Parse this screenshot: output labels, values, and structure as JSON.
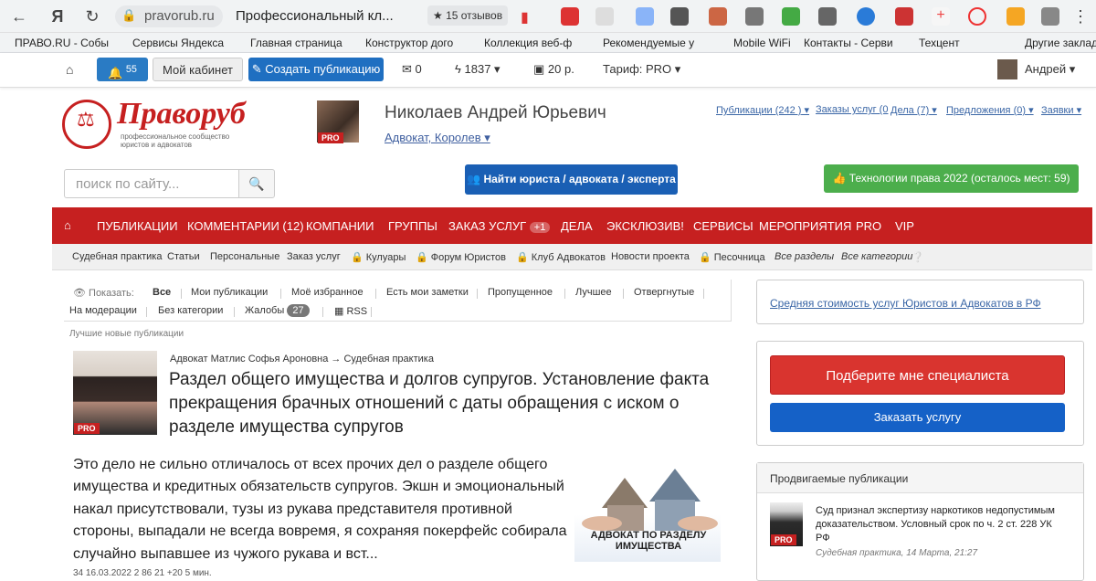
{
  "browser": {
    "url": "pravorub.ru",
    "tab_title": "Профессиональный кл...",
    "reviews": "15 отзывов"
  },
  "bookmarks": [
    "ПРАВО.RU - Собы",
    "Сервисы Яндекса",
    "Главная страница",
    "Конструктор дого",
    "Коллекция веб-ф",
    "Рекомендуемые у",
    "Mobile WiFi",
    "Контакты - Серви",
    "Техцент",
    "Другие заклад"
  ],
  "user_toolbar": {
    "notifications": "55",
    "cabinet": "Мой кабинет",
    "create": "Создать публикацию",
    "messages": "0",
    "rating": "1837",
    "balance": "20 р.",
    "tariff": "Тариф: PRO",
    "user": "Андрей"
  },
  "header": {
    "logo_title": "Праворуб",
    "logo_sub": "профессиональное сообщество юристов и адвокатов",
    "author_name": "Николаев Андрей Юрьевич",
    "author_role": "Адвокат, Королев",
    "pro": "PRO",
    "links": [
      "Публикации (242 )",
      "Заказы услуг (0",
      "Дела (7)",
      "Предложения (0)",
      "Заявки"
    ],
    "search_placeholder": "поиск по сайту...",
    "find_lawyer": "Найти юриста / адвоката / эксперта",
    "tech": "Технологии права 2022 (осталось мест: 59)"
  },
  "main_menu": [
    "ПУБЛИКАЦИИ",
    "КОММЕНТАРИИ (12)",
    "КОМПАНИИ",
    "ГРУППЫ",
    "ЗАКАЗ УСЛУГ",
    "ДЕЛА",
    "ЭКСКЛЮЗИВ!",
    "СЕРВИСЫ",
    "МЕРОПРИЯТИЯ",
    "PRO",
    "VIP"
  ],
  "order_count": "+1",
  "sub_menu": [
    "Судебная практика",
    "Статьи",
    "Персональные",
    "Заказ услуг",
    "Кулуары",
    "Форум Юристов",
    "Клуб Адвокатов",
    "Новости проекта",
    "Песочница",
    "Все разделы",
    "Все категории"
  ],
  "filter": {
    "show": "Показать:",
    "row1": [
      "Все",
      "Мои публикации",
      "Моё избранное",
      "Есть мои заметки",
      "Пропущенное",
      "Лучшее",
      "Отвергнутые"
    ],
    "row2": [
      "На модерации",
      "Без категории",
      "Жалобы"
    ],
    "complaints": "27",
    "rss": "RSS",
    "best_label": "Лучшие новые публикации"
  },
  "article": {
    "meta": "Адвокат Матлис Софья Ароновна → Судебная практика",
    "title": "Раздел общего имущества и долгов супругов. Установление факта прекращения брачных отношений с даты обращения с иском о разделе имущества супругов",
    "excerpt": "Это дело не сильно отличалось от всех прочих дел о разделе общего имущества и кредитных обязательств супругов. Экшн и эмоциональный накал присутствовали, тузы из рукава представителя противной стороны, выпадали не всегда вовремя, я сохраняя покерфейс собирала случайно выпавшее из чужого рукава и вст...",
    "pro": "PRO",
    "image_text": "АДВОКАТ ПО РАЗДЕЛУ ИМУЩЕСТВА",
    "stats": "34   16.03.2022   2   86   21 +20   5 мин."
  },
  "sidebar": {
    "avg_link": "Средняя стоимость услуг Юристов и Адвокатов в РФ",
    "pick": "Подберите мне специалиста",
    "order": "Заказать услугу",
    "promo_title": "Продвигаемые публикации",
    "promo_text": "Суд признал экспертизу наркотиков недопустимым доказательством. Условный срок по ч. 2 ст. 228 УК РФ",
    "promo_date": "Судебная практика, 14 Марта, 21:27",
    "pro": "PRO"
  },
  "colors": {
    "brand_red": "#c62020",
    "blue": "#1a5fb4",
    "green": "#4cae4c"
  }
}
